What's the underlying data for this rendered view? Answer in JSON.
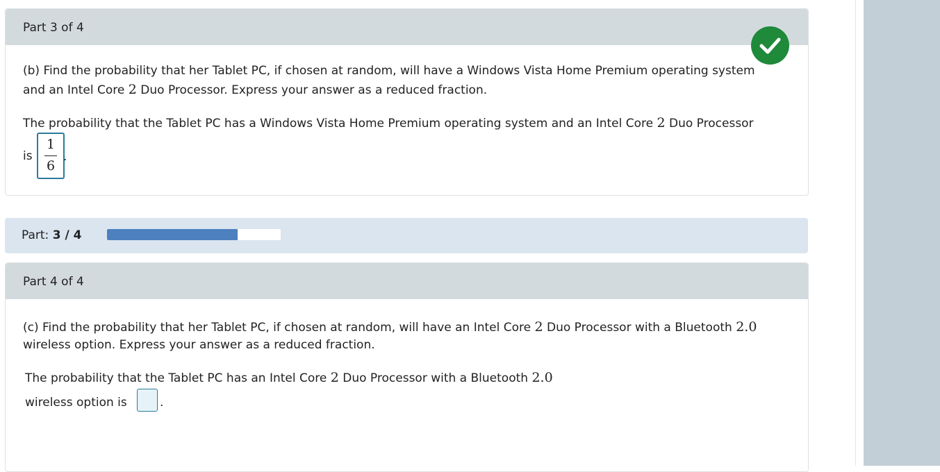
{
  "part3": {
    "header": "Part 3 of 4",
    "status": "correct",
    "question_line1": "(b) Find the probability that her Tablet PC, if chosen at random, will have a Windows Vista Home Premium operating system",
    "question_line2_a": "and an Intel Core ",
    "question_line2_num": "2",
    "question_line2_b": " Duo Processor. Express your answer as a reduced fraction.",
    "answer_line1_a": "The probability that the Tablet PC has a Windows Vista Home Premium operating system and an Intel Core ",
    "answer_line1_num": "2",
    "answer_line1_b": " Duo Processor",
    "answer_is": "is",
    "answer_numerator": "1",
    "answer_denominator": "6",
    "answer_period": "."
  },
  "progress": {
    "label": "Part:",
    "current": "3",
    "separator": "/",
    "total": "4",
    "fraction_complete": 0.75,
    "fill_color": "#4c80bf"
  },
  "part4": {
    "header": "Part 4 of 4",
    "question_line1_a": "(c) Find the probability that her Tablet PC, if chosen at random, will have an Intel Core ",
    "question_line1_num": "2",
    "question_line1_b": " Duo Processor with a Bluetooth ",
    "question_line1_ver": "2.0",
    "question_line2": "wireless option. Express your answer as a reduced fraction.",
    "answer_line1_a": "The probability that the Tablet PC has an Intel Core ",
    "answer_line1_num": "2",
    "answer_line1_b": " Duo Processor with a Bluetooth ",
    "answer_line1_ver": "2.0",
    "answer_line2": "wireless option is",
    "answer_value": "",
    "answer_period": "."
  },
  "colors": {
    "header_bg": "#d3dade",
    "success_green": "#1e8a3a",
    "progress_band": "#dae5ef",
    "input_border": "#2a7b9b",
    "sidebar": "#c3cfd6"
  }
}
